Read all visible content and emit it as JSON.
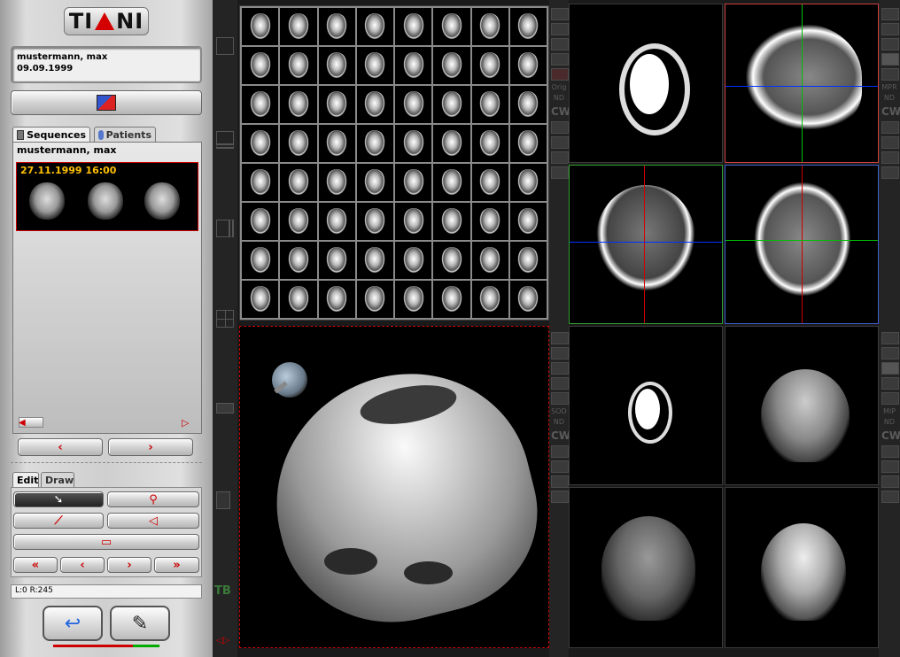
{
  "app": {
    "logo_text": "TIANI"
  },
  "patient": {
    "name": "mustermann, max",
    "birthdate": "09.09.1999"
  },
  "tabs": [
    {
      "label": "Sequences"
    },
    {
      "label": "Patients"
    }
  ],
  "sequence_list": {
    "patient_name": "mustermann, max",
    "items": [
      {
        "datetime": "27.11.1999 16:00"
      }
    ]
  },
  "tool_tabs": [
    {
      "label": "Edit"
    },
    {
      "label": "Draw"
    }
  ],
  "status": {
    "window_level": "L:0 R:245"
  },
  "toolbar_right_upper": {
    "labels": [
      "Orig",
      "ND",
      "CW"
    ]
  },
  "toolbar_right_lower": {
    "labels": [
      "SOD",
      "ND",
      "CW"
    ]
  },
  "toolbar_far_right_upper": {
    "labels": [
      "MPR",
      "ND",
      "CW"
    ]
  },
  "toolbar_far_right_lower": {
    "labels": [
      "MIP",
      "ND",
      "CW"
    ]
  },
  "left_toolbar": {
    "tb_label": "TB"
  },
  "colors": {
    "accent_red": "#cc0000",
    "crosshair_green": "#00c000",
    "crosshair_blue": "#0030ff",
    "date_yellow": "#ffc000"
  }
}
